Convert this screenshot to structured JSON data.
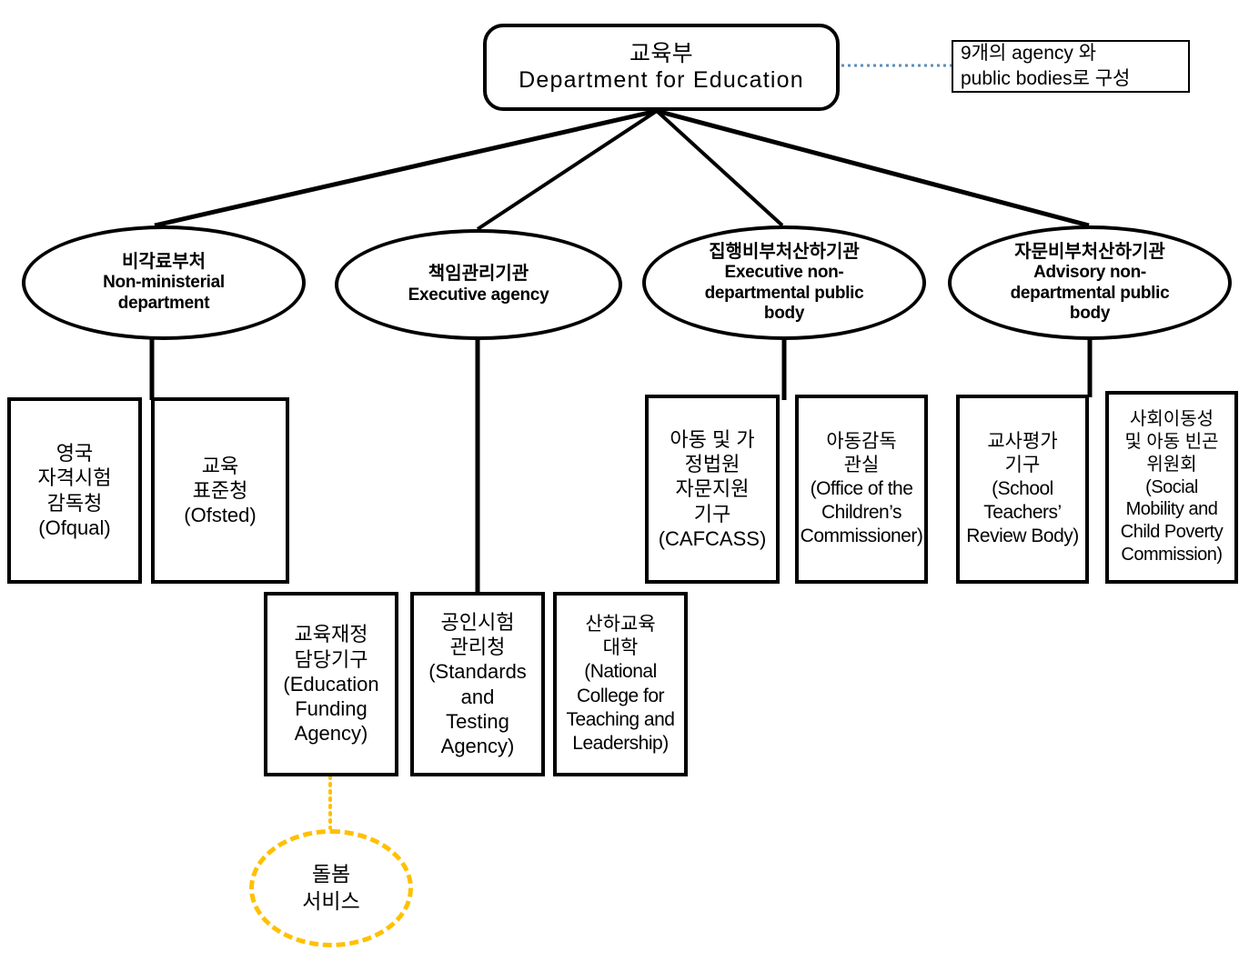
{
  "diagram": {
    "title_node": {
      "ko": "교육부",
      "en": "Department for Education"
    },
    "note": {
      "line1": "9개의 agency 와",
      "line2": "public bodies로 구성"
    },
    "categories": [
      {
        "ko": "비각료부처",
        "en_line1": "Non-ministerial",
        "en_line2": "department"
      },
      {
        "ko": "책임관리기관",
        "en_line1": "Executive agency",
        "en_line2": ""
      },
      {
        "ko": "집행비부처산하기관",
        "en_line1": "Executive non-",
        "en_line2": "departmental public",
        "en_line3": "body"
      },
      {
        "ko": "자문비부처산하기관",
        "en_line1": "Advisory non-",
        "en_line2": "departmental public",
        "en_line3": "body"
      }
    ],
    "bodies": {
      "ofqual": {
        "l1": "영국",
        "l2": "자격시험",
        "l3": "감독청",
        "l4": "(Ofqual)"
      },
      "ofsted": {
        "l1": "교육",
        "l2": "표준청",
        "l3": "(Ofsted)"
      },
      "cafcass": {
        "l1": "아동 및 가",
        "l2": "정법원",
        "l3": "자문지원",
        "l4": "기구",
        "l5": "(CAFCASS)"
      },
      "childrens_commissioner": {
        "l1": "아동감독",
        "l2": "관실",
        "l3": "(Office of the",
        "l4": "Children’s",
        "l5": "Commissioner)"
      },
      "school_teachers_review": {
        "l1": "교사평가",
        "l2": "기구",
        "l3": "(School",
        "l4": "Teachers’",
        "l5": "Review Body)"
      },
      "social_mobility": {
        "l1": "사회이동성",
        "l2": "및 아동 빈곤",
        "l3": "위원회",
        "l4": "(Social",
        "l5": "Mobility and",
        "l6": "Child Poverty",
        "l7": "Commission)"
      },
      "education_funding": {
        "l1": "교육재정",
        "l2": "담당기구",
        "l3": "(Education",
        "l4": "Funding",
        "l5": "Agency)"
      },
      "standards_testing": {
        "l1": "공인시험",
        "l2": "관리청",
        "l3": "(Standards",
        "l4": "and",
        "l5": "Testing",
        "l6": "Agency)"
      },
      "national_college": {
        "l1": "산하교육",
        "l2": "대학",
        "l3": "(National",
        "l4": "College for",
        "l5": "Teaching and",
        "l6": "Leadership)"
      },
      "care_service": {
        "l1": "돌봄",
        "l2": "서비스"
      }
    },
    "colors": {
      "line": "#000000",
      "note_connector": "#5b8db8",
      "highlight": "#ffc000"
    }
  }
}
